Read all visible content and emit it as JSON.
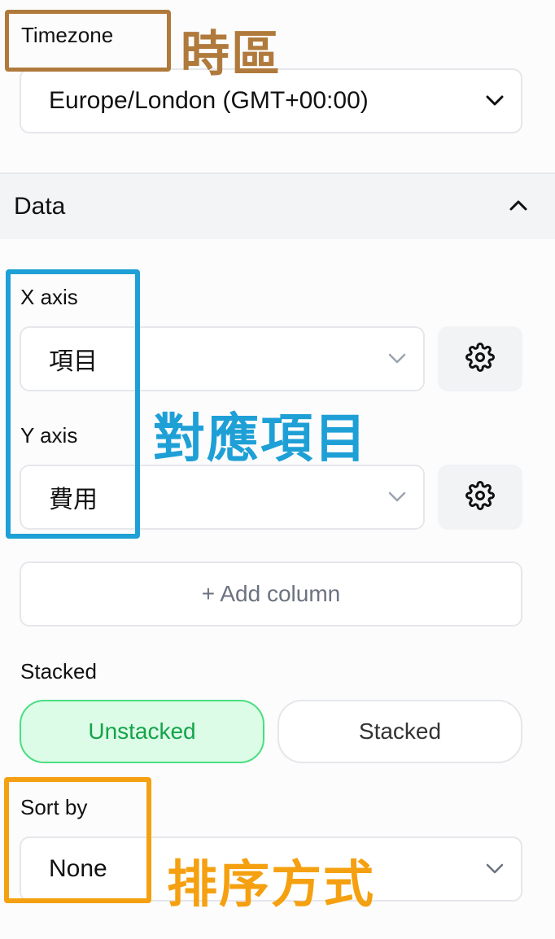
{
  "timezone": {
    "label": "Timezone",
    "value": "Europe/London (GMT+00:00)"
  },
  "data_section": {
    "title": "Data"
  },
  "x_axis": {
    "label": "X axis",
    "value": "項目"
  },
  "y_axis": {
    "label": "Y axis",
    "value": "費用"
  },
  "add_column": {
    "label": "+ Add column"
  },
  "stacked": {
    "label": "Stacked",
    "options": [
      "Unstacked",
      "Stacked"
    ],
    "selected": "Unstacked"
  },
  "sort": {
    "label": "Sort by",
    "value": "None"
  },
  "annotations": {
    "timezone_note": "時區",
    "axis_note": "對應項目",
    "sort_note": "排序方式"
  },
  "colors": {
    "annotation_brown": "#b07a3c",
    "annotation_blue": "#1ea0d6",
    "annotation_orange": "#f5a010",
    "toggle_active_bg": "#dcfce7",
    "toggle_active_text": "#16a34a"
  }
}
